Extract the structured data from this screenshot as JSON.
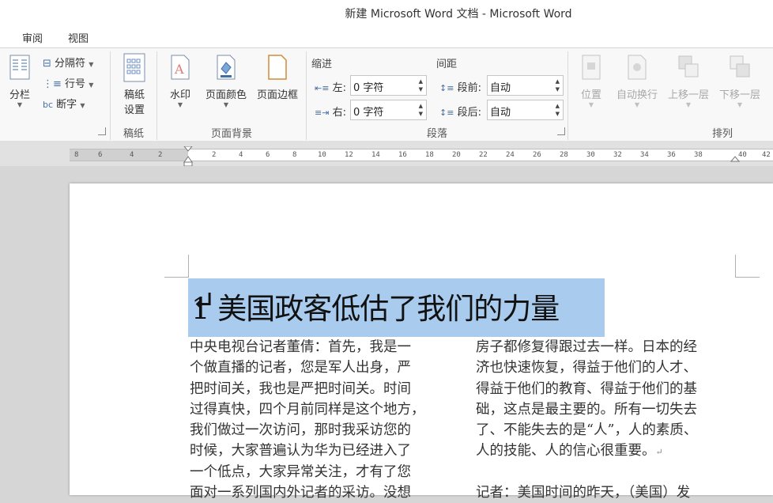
{
  "window": {
    "title": "新建 Microsoft Word 文档 - Microsoft Word"
  },
  "tabs": [
    "审阅",
    "视图"
  ],
  "ribbon": {
    "page_setup": {
      "columns_label": "分栏",
      "breaks_label": "分隔符",
      "line_numbers_label": "行号",
      "hyphenation_label": "断字"
    },
    "draft_paper": {
      "button_label": "稿纸设置",
      "button_line1": "稿纸",
      "button_line2": "设置",
      "group_label": "稿纸"
    },
    "page_background": {
      "watermark_label": "水印",
      "page_color_label": "页面颜色",
      "page_borders_label": "页面边框",
      "group_label": "页面背景"
    },
    "paragraph": {
      "indent_header": "缩进",
      "spacing_header": "间距",
      "indent_left_label": "左:",
      "indent_left_value": "0 字符",
      "indent_right_label": "右:",
      "indent_right_value": "0 字符",
      "spacing_before_label": "段前:",
      "spacing_before_value": "自动",
      "spacing_after_label": "段后:",
      "spacing_after_value": "自动",
      "group_label": "段落"
    },
    "arrange": {
      "position_label": "位置",
      "wrap_text_label": "自动换行",
      "bring_forward_label": "上移一层",
      "send_backward_label": "下移一层",
      "group_label": "排列"
    }
  },
  "ruler": {
    "ticks": [
      "8",
      "6",
      "4",
      "2",
      "2",
      "4",
      "6",
      "8",
      "10",
      "12",
      "14",
      "16",
      "18",
      "20",
      "22",
      "24",
      "26",
      "28",
      "30",
      "32",
      "34",
      "36",
      "38",
      "40",
      "42"
    ]
  },
  "document": {
    "heading": "1 美国政客低估了我们的力量",
    "left_column": [
      "中央电视台记者董倩：首先，我是一",
      "个做直播的记者，您是军人出身，严",
      "把时间关，我也是严把时间关。时间",
      "过得真快，四个月前同样是这个地方，",
      "我们做过一次访问，那时我采访您的",
      "时候，大家普遍认为华为已经进入了",
      "一个低点，大家异常关注，才有了您",
      "面对一系列国内外记者的采访。没想"
    ],
    "right_column": [
      "房子都修复得跟过去一样。日本的经",
      "济也快速恢复，得益于他们的人才、",
      "得益于他们的教育、得益于他们的基",
      "础，这点是最主要的。所有一切失去",
      "了、不能失去的是“人”，人的素质、",
      "人的技能、人的信心很重要。"
    ],
    "right_column_next": "记者：美国时间的昨天，（美国）发"
  }
}
